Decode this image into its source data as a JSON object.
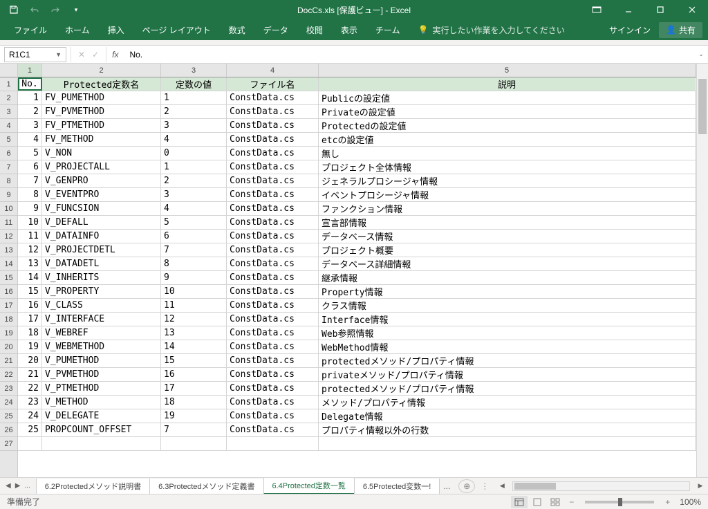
{
  "title": "DocCs.xls [保護ビュー] - Excel",
  "ribbon": {
    "tabs": [
      "ファイル",
      "ホーム",
      "挿入",
      "ページ レイアウト",
      "数式",
      "データ",
      "校閲",
      "表示",
      "チーム"
    ],
    "tellme": "実行したい作業を入力してください",
    "signin": "サインイン",
    "share": "共有"
  },
  "nameBox": "R1C1",
  "formulaValue": "No.",
  "colHeaders": [
    "1",
    "2",
    "3",
    "4",
    "5"
  ],
  "headers": [
    "No.",
    "Protected定数名",
    "定数の値",
    "ファイル名",
    "説明"
  ],
  "rows": [
    {
      "n": "1",
      "name": "FV_PUMETHOD",
      "val": "1",
      "file": "ConstData.cs",
      "desc": "Publicの設定値"
    },
    {
      "n": "2",
      "name": "FV_PVMETHOD",
      "val": "2",
      "file": "ConstData.cs",
      "desc": "Privateの設定値"
    },
    {
      "n": "3",
      "name": "FV_PTMETHOD",
      "val": "3",
      "file": "ConstData.cs",
      "desc": "Protectedの設定値"
    },
    {
      "n": "4",
      "name": "FV_METHOD",
      "val": "4",
      "file": "ConstData.cs",
      "desc": "etcの設定値"
    },
    {
      "n": "5",
      "name": "V_NON",
      "val": "0",
      "file": "ConstData.cs",
      "desc": "無し"
    },
    {
      "n": "6",
      "name": "V_PROJECTALL",
      "val": "1",
      "file": "ConstData.cs",
      "desc": "プロジェクト全体情報"
    },
    {
      "n": "7",
      "name": "V_GENPRO",
      "val": "2",
      "file": "ConstData.cs",
      "desc": "ジェネラルプロシージャ情報"
    },
    {
      "n": "8",
      "name": "V_EVENTPRO",
      "val": "3",
      "file": "ConstData.cs",
      "desc": "イベントプロシージャ情報"
    },
    {
      "n": "9",
      "name": "V_FUNCSION",
      "val": "4",
      "file": "ConstData.cs",
      "desc": "ファンクション情報"
    },
    {
      "n": "10",
      "name": "V_DEFALL",
      "val": "5",
      "file": "ConstData.cs",
      "desc": "宣言部情報"
    },
    {
      "n": "11",
      "name": "V_DATAINFO",
      "val": "6",
      "file": "ConstData.cs",
      "desc": "データベース情報"
    },
    {
      "n": "12",
      "name": "V_PROJECTDETL",
      "val": "7",
      "file": "ConstData.cs",
      "desc": "プロジェクト概要"
    },
    {
      "n": "13",
      "name": "V_DATADETL",
      "val": "8",
      "file": "ConstData.cs",
      "desc": "データベース詳細情報"
    },
    {
      "n": "14",
      "name": "V_INHERITS",
      "val": "9",
      "file": "ConstData.cs",
      "desc": "継承情報"
    },
    {
      "n": "15",
      "name": "V_PROPERTY",
      "val": "10",
      "file": "ConstData.cs",
      "desc": "Property情報"
    },
    {
      "n": "16",
      "name": "V_CLASS",
      "val": "11",
      "file": "ConstData.cs",
      "desc": "クラス情報"
    },
    {
      "n": "17",
      "name": "V_INTERFACE",
      "val": "12",
      "file": "ConstData.cs",
      "desc": "Interface情報"
    },
    {
      "n": "18",
      "name": "V_WEBREF",
      "val": "13",
      "file": "ConstData.cs",
      "desc": "Web参照情報"
    },
    {
      "n": "19",
      "name": "V_WEBMETHOD",
      "val": "14",
      "file": "ConstData.cs",
      "desc": "WebMethod情報"
    },
    {
      "n": "20",
      "name": "V_PUMETHOD",
      "val": "15",
      "file": "ConstData.cs",
      "desc": "protectedメソッド/プロパティ情報"
    },
    {
      "n": "21",
      "name": "V_PVMETHOD",
      "val": "16",
      "file": "ConstData.cs",
      "desc": "privateメソッド/プロパティ情報"
    },
    {
      "n": "22",
      "name": "V_PTMETHOD",
      "val": "17",
      "file": "ConstData.cs",
      "desc": "protectedメソッド/プロパティ情報"
    },
    {
      "n": "23",
      "name": "V_METHOD",
      "val": "18",
      "file": "ConstData.cs",
      "desc": "メソッド/プロパティ情報"
    },
    {
      "n": "24",
      "name": "V_DELEGATE",
      "val": "19",
      "file": "ConstData.cs",
      "desc": "Delegate情報"
    },
    {
      "n": "25",
      "name": "PROPCOUNT_OFFSET",
      "val": "7",
      "file": "ConstData.cs",
      "desc": "プロパティ情報以外の行数"
    }
  ],
  "sheetTabs": {
    "overflow": "...",
    "tabs": [
      "6.2Protectedメソッド説明書",
      "6.3Protectedメソッド定義書",
      "6.4Protected定数一覧",
      "6.5Protected変数一!"
    ],
    "more": "...",
    "active": 2
  },
  "status": {
    "ready": "準備完了",
    "zoom": "100%"
  }
}
